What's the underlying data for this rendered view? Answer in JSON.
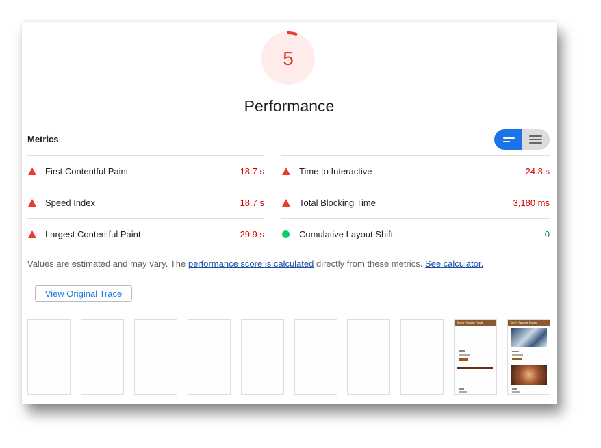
{
  "gauge": {
    "score": "5",
    "title": "Performance",
    "score_fraction": 0.05,
    "color": "#eb3a2e",
    "bg_color": "#fdecea"
  },
  "metrics": {
    "label": "Metrics",
    "toggle": {
      "active_icon": "bars-short-icon",
      "inactive_icon": "bars-long-icon"
    },
    "left": [
      {
        "name": "First Contentful Paint",
        "value": "18.7 s",
        "status": "fail"
      },
      {
        "name": "Speed Index",
        "value": "18.7 s",
        "status": "fail"
      },
      {
        "name": "Largest Contentful Paint",
        "value": "29.9 s",
        "status": "fail"
      }
    ],
    "right": [
      {
        "name": "Time to Interactive",
        "value": "24.8 s",
        "status": "fail"
      },
      {
        "name": "Total Blocking Time",
        "value": "3,180 ms",
        "status": "fail"
      },
      {
        "name": "Cumulative Layout Shift",
        "value": "0",
        "status": "pass"
      }
    ]
  },
  "note": {
    "prefix": "Values are estimated and may vary. The ",
    "link1": "performance score is calculated",
    "middle": " directly from these metrics. ",
    "link2": "See calculator."
  },
  "trace_button": "View Original Trace",
  "filmstrip": {
    "frame_count": 10,
    "thumb_title": "Tony's Favorite Foods"
  },
  "colors": {
    "fail": "#eb3a2e",
    "fail_text": "#d70000",
    "pass": "#0cce6b",
    "pass_text": "#018642",
    "accent": "#1a73e8"
  }
}
